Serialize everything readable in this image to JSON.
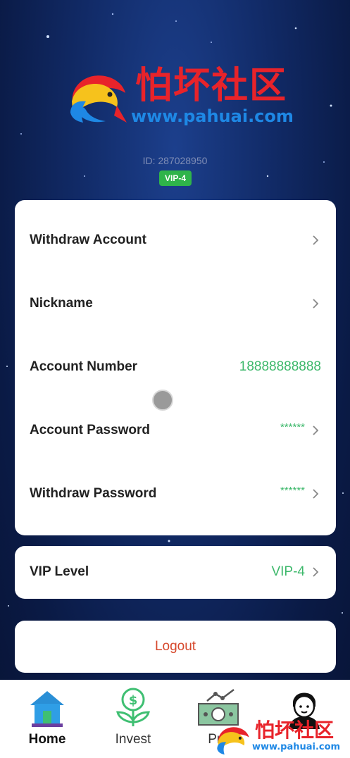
{
  "header": {
    "logo_text_cn": "怕坏社区",
    "logo_url": "www.pahuai.com",
    "user_id": "ID: 287028950",
    "vip_badge": "VIP-4"
  },
  "profile": {
    "rows": [
      {
        "label": "Withdraw Account",
        "value": ""
      },
      {
        "label": "Nickname",
        "value": ""
      },
      {
        "label": "Account Number",
        "value": "18888888888"
      },
      {
        "label": "Account Password",
        "value": "******"
      },
      {
        "label": "Withdraw Password",
        "value": "******"
      }
    ]
  },
  "vip": {
    "label": "VIP Level",
    "value": "VIP-4"
  },
  "logout": {
    "label": "Logout"
  },
  "nav": {
    "items": [
      {
        "label": "Home",
        "icon": "home-icon",
        "active": true
      },
      {
        "label": "Invest",
        "icon": "invest-icon",
        "active": false
      },
      {
        "label": "Pro",
        "icon": "profit-icon",
        "active": false
      },
      {
        "label": "",
        "icon": "user-icon",
        "active": false
      }
    ]
  },
  "watermark": {
    "text_cn": "怕坏社区",
    "url": "www.pahuai.com"
  },
  "colors": {
    "background": "#112a66",
    "accent_green": "#3db86b",
    "logout_red": "#d6482c",
    "badge_green": "#2fb44a"
  }
}
